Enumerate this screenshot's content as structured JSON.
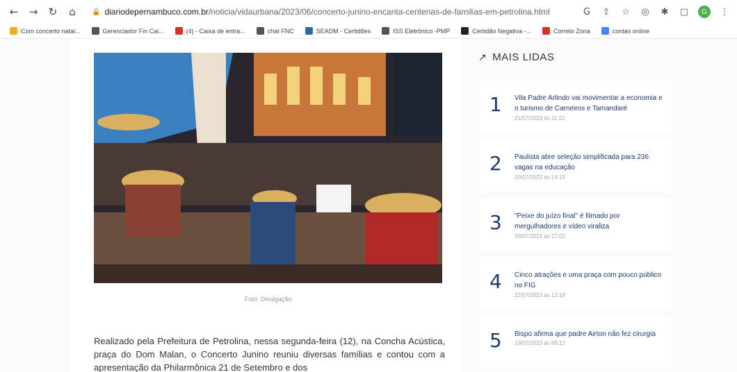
{
  "browser": {
    "url_domain": "diariodepernambuco.com.br",
    "url_path": "/noticia/vidaurbana/2023/06/concerto-junino-encanta-centenas-de-familias-em-petrolina.html",
    "profile_initial": "G"
  },
  "bookmarks": [
    {
      "label": "Com concerto natal...",
      "color": "#f2b01e"
    },
    {
      "label": "Gerenciador Fin Cai...",
      "color": "#555555"
    },
    {
      "label": "(4) - Caixa de entra...",
      "color": "#d93025"
    },
    {
      "label": "chat FNC",
      "color": "#555555"
    },
    {
      "label": "SEADM - Certidões",
      "color": "#3366aa"
    },
    {
      "label": "ISS Eletrônico -PMP",
      "color": "#555555"
    },
    {
      "label": "Certidão Negativa -...",
      "color": "#222222"
    },
    {
      "label": "Correio Zona",
      "color": "#d93025"
    },
    {
      "label": "contas online",
      "color": "#4285f4"
    }
  ],
  "article": {
    "photo_credit": "Foto: Divulgação",
    "body": "Realizado pela Prefeitura de Petrolina, nessa segunda-feira (12), na Concha Acústica, praça do Dom Malan, o Concerto Junino reuniu diversas famílias e contou com a apresentação da Philarmônica 21 de Setembro e dos"
  },
  "sidebar": {
    "title": "MAIS LIDAS",
    "items": [
      {
        "rank": "1",
        "title": "Vila Padre Arlindo vai movimentar a economia e o turismo de Carneiros e Tamandaré",
        "date": "21/07/2023 às 11:12"
      },
      {
        "rank": "2",
        "title": "Paulista abre seleção simplificada para 236 vagas na educação",
        "date": "20/07/2023 às 14:15"
      },
      {
        "rank": "3",
        "title": "\"Peixe do juízo final\" é filmado por mergulhadores e vídeo viraliza",
        "date": "20/07/2023 às 17:02"
      },
      {
        "rank": "4",
        "title": "Cinco atrações e uma praça com pouco público no FIG",
        "date": "22/07/2023 às 13:18"
      },
      {
        "rank": "5",
        "title": "Bispo afirma que padre Airton não fez cirurgia",
        "date": "19/07/2023 às 09:12"
      }
    ]
  }
}
